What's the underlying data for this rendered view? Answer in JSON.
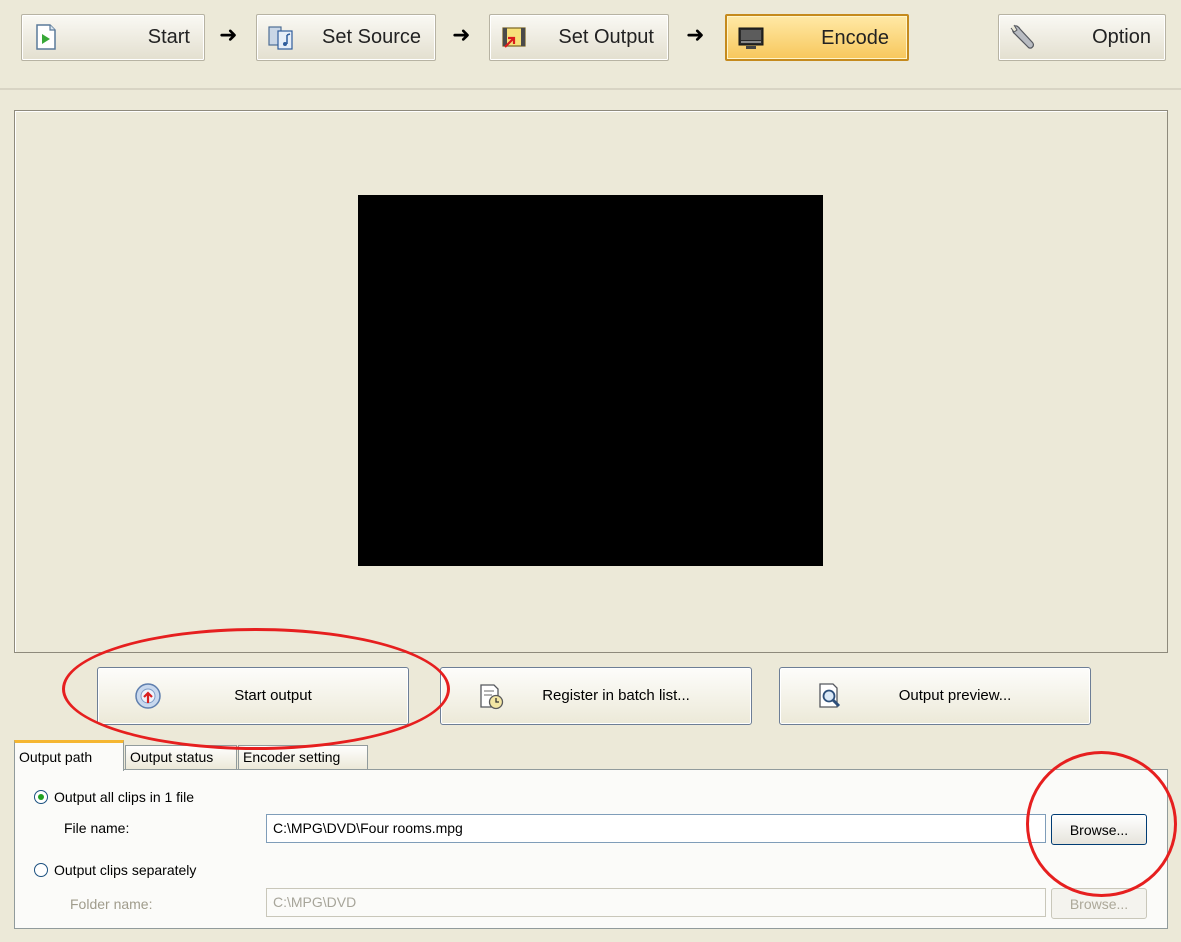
{
  "toolbar": {
    "steps": [
      {
        "label": "Start",
        "icon": "play-page-icon"
      },
      {
        "label": "Set Source",
        "icon": "source-media-icon"
      },
      {
        "label": "Set Output",
        "icon": "output-film-icon"
      },
      {
        "label": "Encode",
        "icon": "monitor-icon"
      }
    ],
    "arrow": "➜",
    "option": {
      "label": "Option",
      "icon": "wrench-icon"
    }
  },
  "actions": {
    "start_output": "Start output",
    "register_batch": "Register in batch list...",
    "output_preview": "Output preview..."
  },
  "tabs": [
    "Output path",
    "Output status",
    "Encoder setting"
  ],
  "output_path": {
    "all_in_one_label": "Output all clips in 1 file",
    "file_name_label": "File name:",
    "file_name_value": "C:\\MPG\\DVD\\Four rooms.mpg",
    "browse_label": "Browse...",
    "separately_label": "Output clips separately",
    "folder_name_label": "Folder name:",
    "folder_name_value": "C:\\MPG\\DVD",
    "browse_disabled_label": "Browse..."
  },
  "colors": {
    "active_step": "#f7c75c",
    "annotation": "#e61f1f",
    "background": "#ece9d8"
  }
}
